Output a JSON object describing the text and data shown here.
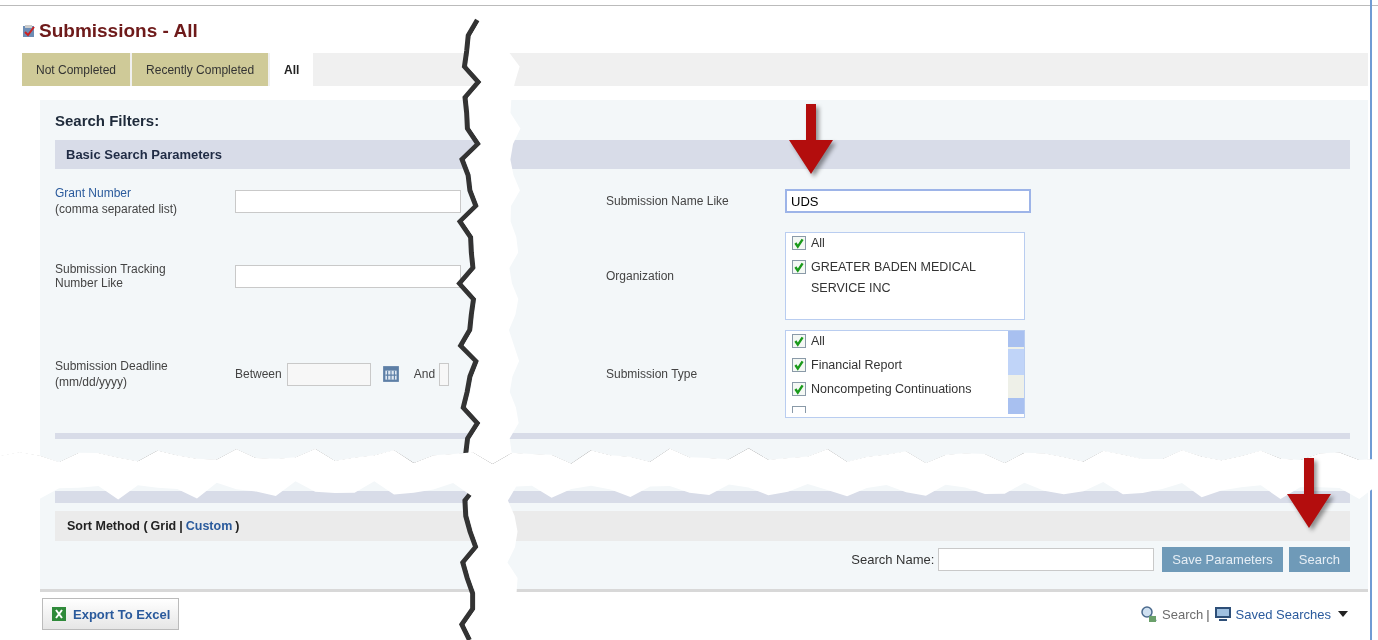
{
  "page": {
    "title": "Submissions - All"
  },
  "tabs": [
    {
      "label": "Not Completed",
      "selected": false
    },
    {
      "label": "Recently Completed",
      "selected": false
    },
    {
      "label": "All",
      "selected": true
    }
  ],
  "filters": {
    "heading": "Search Filters:",
    "basic_section": "Basic Search Parameters",
    "grant_number": {
      "label": "Grant Number",
      "hint": "(comma separated list)"
    },
    "tracking_number": {
      "label": "Submission Tracking Number Like"
    },
    "deadline": {
      "label": "Submission Deadline",
      "hint": "(mm/dd/yyyy)",
      "between": "Between",
      "and": "And"
    },
    "submission_name": {
      "label": "Submission Name Like",
      "value": "UDS"
    },
    "organization": {
      "label": "Organization",
      "options": [
        {
          "label": "All",
          "checked": true
        },
        {
          "label": "GREATER BADEN MEDICAL SERVICE INC",
          "checked": true
        }
      ]
    },
    "submission_type": {
      "label": "Submission Type",
      "options": [
        {
          "label": "All",
          "checked": true
        },
        {
          "label": "Financial Report",
          "checked": true
        },
        {
          "label": "Noncompeting Continuations",
          "checked": true
        }
      ]
    }
  },
  "sort_method": {
    "prefix": "Sort Method (",
    "options": [
      {
        "label": "Grid",
        "selected": true
      },
      {
        "label": "Custom",
        "selected": false
      }
    ],
    "separator": "|",
    "suffix": ")"
  },
  "save_bar": {
    "label": "Search Name:",
    "buttons": [
      "Save Parameters",
      "Search"
    ]
  },
  "footer": {
    "export": "Export To Excel",
    "search_link": "Search",
    "separator": "|",
    "saved_searches": "Saved Searches"
  }
}
